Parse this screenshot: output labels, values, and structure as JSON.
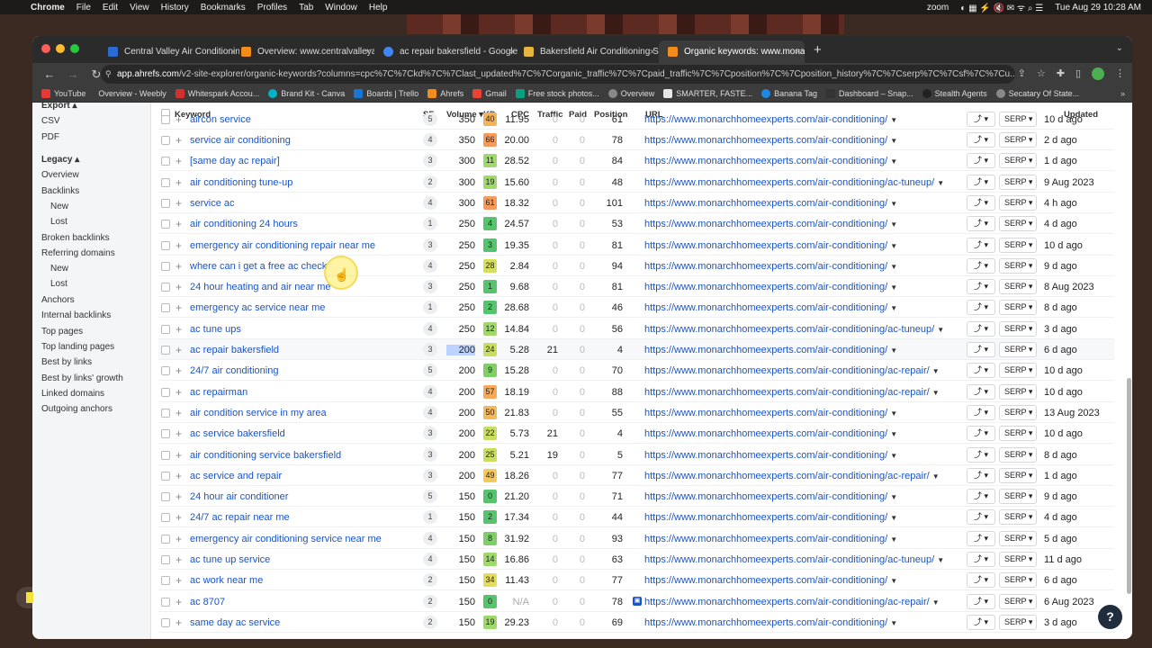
{
  "menubar": {
    "app": "Chrome",
    "menus": [
      "File",
      "Edit",
      "View",
      "History",
      "Bookmarks",
      "Profiles",
      "Tab",
      "Window",
      "Help"
    ],
    "zoom_label": "zoom",
    "datetime": "Tue Aug 29  10:28 AM"
  },
  "tabs": [
    {
      "title": "Central Valley Air Conditioning",
      "fav_color": "#2b6cd4"
    },
    {
      "title": "Overview: www.centralvalleya",
      "fav_color": "#f28c1b"
    },
    {
      "title": "ac repair bakersfield - Google",
      "fav_color": "#4285f4"
    },
    {
      "title": "Bakersfield Air Conditioning Se",
      "fav_color": "#e7b341"
    },
    {
      "title": "Organic keywords: www.mona",
      "fav_color": "#f28c1b"
    }
  ],
  "toolbar": {
    "url_host": "app.ahrefs.com",
    "url_path": "/v2-site-explorer/organic-keywords?columns=cpc%7C%7Ckd%7C%7Clast_updated%7C%7Corganic_traffic%7C%7Cpaid_traffic%7C%7Cposition%7C%7Cposition_history%7C%7Cserp%7C%7Csf%7C%7Cu..."
  },
  "bookmarks": [
    {
      "label": "YouTube",
      "color": "#e53935"
    },
    {
      "label": "Overview - Weebly",
      "color": "#2f2f2f"
    },
    {
      "label": "Whitespark Accou...",
      "color": "#d32f2f"
    },
    {
      "label": "Brand Kit - Canva",
      "color": "#00b3c4"
    },
    {
      "label": "Boards | Trello",
      "color": "#1976d2"
    },
    {
      "label": "Ahrefs",
      "color": "#f28c1b"
    },
    {
      "label": "Gmail",
      "color": "#ea4335"
    },
    {
      "label": "Free stock photos...",
      "color": "#07a081"
    },
    {
      "label": "Overview",
      "color": "#555555"
    },
    {
      "label": "SMARTER, FASTE...",
      "color": "#e8e8e8"
    },
    {
      "label": "Banana Tag",
      "color": "#1e88e5"
    },
    {
      "label": "Dashboard – Snap...",
      "color": "#333333"
    },
    {
      "label": "Stealth Agents",
      "color": "#222222"
    },
    {
      "label": "Secatary Of State...",
      "color": "#888888"
    }
  ],
  "sidebar": {
    "export": "Export ▴",
    "export_items": [
      "CSV",
      "PDF"
    ],
    "legacy": "Legacy ▴",
    "items": [
      "Overview",
      "Backlinks",
      "New",
      "Lost",
      "Broken backlinks",
      "Referring domains",
      "New",
      "Lost",
      "Anchors",
      "Internal backlinks",
      "Top pages",
      "Top landing pages",
      "Best by links",
      "Best by links' growth",
      "Linked domains",
      "Outgoing anchors"
    ]
  },
  "table": {
    "headers": {
      "keyword": "Keyword",
      "sf": "SF",
      "volume": "Volume ▾",
      "kd": "KD",
      "cpc": "CPC",
      "traffic": "Traffic",
      "paid": "Paid",
      "position": "Position",
      "url": "URL",
      "updated": "Updated"
    },
    "serp_label": "SERP",
    "rows": [
      {
        "kw": "aircon service",
        "sf": "5",
        "vol": "350",
        "kd": "40",
        "kd_color": "#f2b35c",
        "cpc": "11.95",
        "traffic": "0",
        "paid": "0",
        "pos": "61",
        "url": "https://www.monarchhomeexperts.com/air-conditioning/",
        "upd": "10 d ago"
      },
      {
        "kw": "service air conditioning",
        "sf": "4",
        "vol": "350",
        "kd": "66",
        "kd_color": "#f59a5b",
        "cpc": "20.00",
        "traffic": "0",
        "paid": "0",
        "pos": "78",
        "url": "https://www.monarchhomeexperts.com/air-conditioning/",
        "upd": "2 d ago"
      },
      {
        "kw": "[same day ac repair]",
        "sf": "3",
        "vol": "300",
        "kd": "11",
        "kd_color": "#9fd86b",
        "cpc": "28.52",
        "traffic": "0",
        "paid": "0",
        "pos": "84",
        "url": "https://www.monarchhomeexperts.com/air-conditioning/",
        "upd": "1 d ago"
      },
      {
        "kw": "air conditioning tune-up",
        "sf": "2",
        "vol": "300",
        "kd": "19",
        "kd_color": "#9fd86b",
        "cpc": "15.60",
        "traffic": "0",
        "paid": "0",
        "pos": "48",
        "url": "https://www.monarchhomeexperts.com/air-conditioning/ac-tuneup/",
        "upd": "9 Aug 2023"
      },
      {
        "kw": "service ac",
        "sf": "4",
        "vol": "300",
        "kd": "61",
        "kd_color": "#f59a5b",
        "cpc": "18.32",
        "traffic": "0",
        "paid": "0",
        "pos": "101",
        "url": "https://www.monarchhomeexperts.com/air-conditioning/",
        "upd": "4 h ago"
      },
      {
        "kw": "air conditioning 24 hours",
        "sf": "1",
        "vol": "250",
        "kd": "4",
        "kd_color": "#56c46c",
        "cpc": "24.57",
        "traffic": "0",
        "paid": "0",
        "pos": "53",
        "url": "https://www.monarchhomeexperts.com/air-conditioning/",
        "upd": "4 d ago"
      },
      {
        "kw": "emergency air conditioning repair near me",
        "sf": "3",
        "vol": "250",
        "kd": "3",
        "kd_color": "#56c46c",
        "cpc": "19.35",
        "traffic": "0",
        "paid": "0",
        "pos": "81",
        "url": "https://www.monarchhomeexperts.com/air-conditioning/",
        "upd": "10 d ago"
      },
      {
        "kw": "where can i get a free ac check",
        "sf": "4",
        "vol": "250",
        "kd": "28",
        "kd_color": "#d6df5c",
        "cpc": "2.84",
        "traffic": "0",
        "paid": "0",
        "pos": "94",
        "url": "https://www.monarchhomeexperts.com/air-conditioning/",
        "upd": "9 d ago"
      },
      {
        "kw": "24 hour heating and air near me",
        "sf": "3",
        "vol": "250",
        "kd": "1",
        "kd_color": "#56c46c",
        "cpc": "9.68",
        "traffic": "0",
        "paid": "0",
        "pos": "81",
        "url": "https://www.monarchhomeexperts.com/air-conditioning/",
        "upd": "8 Aug 2023"
      },
      {
        "kw": "emergency ac service near me",
        "sf": "1",
        "vol": "250",
        "kd": "2",
        "kd_color": "#56c46c",
        "cpc": "28.68",
        "traffic": "0",
        "paid": "0",
        "pos": "46",
        "url": "https://www.monarchhomeexperts.com/air-conditioning/",
        "upd": "8 d ago"
      },
      {
        "kw": "ac tune ups",
        "sf": "4",
        "vol": "250",
        "kd": "12",
        "kd_color": "#9fd86b",
        "cpc": "14.84",
        "traffic": "0",
        "paid": "0",
        "pos": "56",
        "url": "https://www.monarchhomeexperts.com/air-conditioning/ac-tuneup/",
        "upd": "3 d ago"
      },
      {
        "kw": "ac repair bakersfield",
        "sf": "3",
        "vol": "200",
        "kd": "24",
        "kd_color": "#c9dd5e",
        "cpc": "5.28",
        "traffic": "21",
        "paid": "0",
        "pos": "4",
        "url": "https://www.monarchhomeexperts.com/air-conditioning/",
        "upd": "6 d ago",
        "selected": true
      },
      {
        "kw": "24/7 air conditioning",
        "sf": "5",
        "vol": "200",
        "kd": "9",
        "kd_color": "#7fcf68",
        "cpc": "15.28",
        "traffic": "0",
        "paid": "0",
        "pos": "70",
        "url": "https://www.monarchhomeexperts.com/air-conditioning/ac-repair/",
        "upd": "10 d ago"
      },
      {
        "kw": "ac repairman",
        "sf": "4",
        "vol": "200",
        "kd": "57",
        "kd_color": "#f5a95b",
        "cpc": "18.19",
        "traffic": "0",
        "paid": "0",
        "pos": "88",
        "url": "https://www.monarchhomeexperts.com/air-conditioning/ac-repair/",
        "upd": "10 d ago"
      },
      {
        "kw": "air condition service in my area",
        "sf": "4",
        "vol": "200",
        "kd": "50",
        "kd_color": "#f5b85b",
        "cpc": "21.83",
        "traffic": "0",
        "paid": "0",
        "pos": "55",
        "url": "https://www.monarchhomeexperts.com/air-conditioning/",
        "upd": "13 Aug 2023"
      },
      {
        "kw": "ac service bakersfield",
        "sf": "3",
        "vol": "200",
        "kd": "22",
        "kd_color": "#c9dd5e",
        "cpc": "5.73",
        "traffic": "21",
        "paid": "0",
        "pos": "4",
        "url": "https://www.monarchhomeexperts.com/air-conditioning/",
        "upd": "10 d ago"
      },
      {
        "kw": "air conditioning service bakersfield",
        "sf": "3",
        "vol": "200",
        "kd": "25",
        "kd_color": "#c9dd5e",
        "cpc": "5.21",
        "traffic": "19",
        "paid": "0",
        "pos": "5",
        "url": "https://www.monarchhomeexperts.com/air-conditioning/",
        "upd": "8 d ago"
      },
      {
        "kw": "ac service and repair",
        "sf": "3",
        "vol": "200",
        "kd": "49",
        "kd_color": "#f5c95b",
        "cpc": "18.26",
        "traffic": "0",
        "paid": "0",
        "pos": "77",
        "url": "https://www.monarchhomeexperts.com/air-conditioning/ac-repair/",
        "upd": "1 d ago"
      },
      {
        "kw": "24 hour air conditioner",
        "sf": "5",
        "vol": "150",
        "kd": "0",
        "kd_color": "#56c46c",
        "cpc": "21.20",
        "traffic": "0",
        "paid": "0",
        "pos": "71",
        "url": "https://www.monarchhomeexperts.com/air-conditioning/",
        "upd": "9 d ago"
      },
      {
        "kw": "24/7 ac repair near me",
        "sf": "1",
        "vol": "150",
        "kd": "2",
        "kd_color": "#56c46c",
        "cpc": "17.34",
        "traffic": "0",
        "paid": "0",
        "pos": "44",
        "url": "https://www.monarchhomeexperts.com/air-conditioning/",
        "upd": "4 d ago"
      },
      {
        "kw": "emergency air conditioning service near me",
        "sf": "4",
        "vol": "150",
        "kd": "8",
        "kd_color": "#7fcf68",
        "cpc": "31.92",
        "traffic": "0",
        "paid": "0",
        "pos": "93",
        "url": "https://www.monarchhomeexperts.com/air-conditioning/",
        "upd": "5 d ago"
      },
      {
        "kw": "ac tune up service",
        "sf": "4",
        "vol": "150",
        "kd": "14",
        "kd_color": "#9fd86b",
        "cpc": "16.86",
        "traffic": "0",
        "paid": "0",
        "pos": "63",
        "url": "https://www.monarchhomeexperts.com/air-conditioning/ac-tuneup/",
        "upd": "11 d ago"
      },
      {
        "kw": "ac work near me",
        "sf": "2",
        "vol": "150",
        "kd": "34",
        "kd_color": "#e3dc5c",
        "cpc": "11.43",
        "traffic": "0",
        "paid": "0",
        "pos": "77",
        "url": "https://www.monarchhomeexperts.com/air-conditioning/",
        "upd": "6 d ago"
      },
      {
        "kw": "ac 8707",
        "sf": "2",
        "vol": "150",
        "kd": "0",
        "kd_color": "#56c46c",
        "cpc": "N/A",
        "traffic": "0",
        "paid": "0",
        "pos": "78",
        "url": "https://www.monarchhomeexperts.com/air-conditioning/ac-repair/",
        "upd": "6 Aug 2023",
        "has_icon": true
      },
      {
        "kw": "same day ac service",
        "sf": "2",
        "vol": "150",
        "kd": "19",
        "kd_color": "#9fd86b",
        "cpc": "29.23",
        "traffic": "0",
        "paid": "0",
        "pos": "69",
        "url": "https://www.monarchhomeexperts.com/air-conditioning/",
        "upd": "3 d ago"
      }
    ]
  },
  "help_label": "?"
}
